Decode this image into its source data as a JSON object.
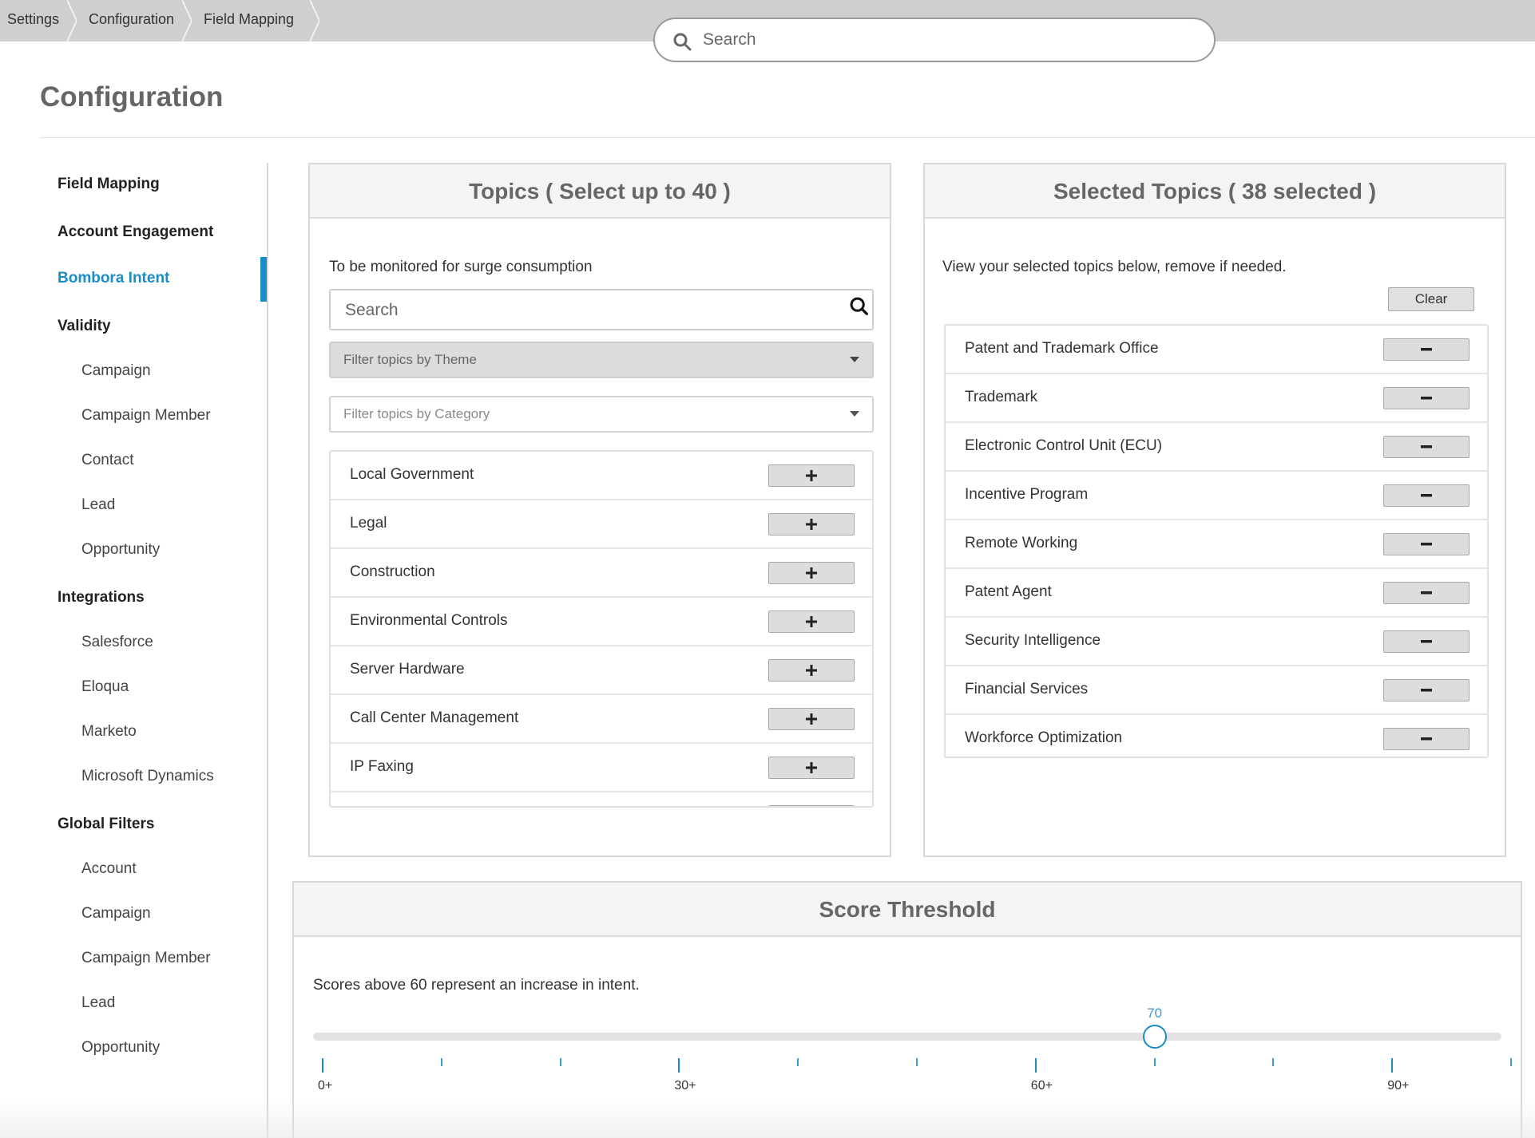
{
  "breadcrumb": [
    "Settings",
    "Configuration",
    "Field Mapping"
  ],
  "top_search": {
    "placeholder": "Search"
  },
  "page_title": "Configuration",
  "sidebar": {
    "items": [
      {
        "label": "Field Mapping",
        "kind": "head"
      },
      {
        "label": "Account Engagement",
        "kind": "head"
      },
      {
        "label": "Bombora Intent",
        "kind": "head",
        "active": true
      },
      {
        "label": "Validity",
        "kind": "head"
      },
      {
        "label": "Campaign",
        "kind": "sub"
      },
      {
        "label": "Campaign Member",
        "kind": "sub"
      },
      {
        "label": "Contact",
        "kind": "sub"
      },
      {
        "label": "Lead",
        "kind": "sub"
      },
      {
        "label": "Opportunity",
        "kind": "sub"
      },
      {
        "label": "Integrations",
        "kind": "head"
      },
      {
        "label": "Salesforce",
        "kind": "sub"
      },
      {
        "label": "Eloqua",
        "kind": "sub"
      },
      {
        "label": "Marketo",
        "kind": "sub"
      },
      {
        "label": "Microsoft Dynamics",
        "kind": "sub"
      },
      {
        "label": "Global Filters",
        "kind": "head"
      },
      {
        "label": "Account",
        "kind": "sub"
      },
      {
        "label": "Campaign",
        "kind": "sub"
      },
      {
        "label": "Campaign Member",
        "kind": "sub"
      },
      {
        "label": "Lead",
        "kind": "sub"
      },
      {
        "label": "Opportunity",
        "kind": "sub"
      }
    ]
  },
  "topics_panel": {
    "title": "Topics ( Select up to 40 )",
    "description": "To be monitored for surge consumption",
    "search_placeholder": "Search",
    "filter_theme": "Filter topics by Theme",
    "filter_category": "Filter topics by Category",
    "topics": [
      "Local Government",
      "Legal",
      "Construction",
      "Environmental Controls",
      "Server Hardware",
      "Call Center Management",
      "IP Faxing"
    ]
  },
  "selected_panel": {
    "title": "Selected Topics ( 38 selected )",
    "description": "View your selected topics below, remove if needed.",
    "clear_label": "Clear",
    "topics": [
      "Patent and Trademark Office",
      "Trademark",
      "Electronic Control Unit (ECU)",
      "Incentive Program",
      "Remote Working",
      "Patent Agent",
      "Security Intelligence",
      "Financial Services",
      "Workforce Optimization"
    ]
  },
  "score_panel": {
    "title": "Score Threshold",
    "description": "Scores above 60 represent an increase in intent.",
    "slider": {
      "min": 0,
      "max": 100,
      "value": 70,
      "value_label": "70",
      "tick_step": 10,
      "major_labels": [
        "0+",
        "30+",
        "60+",
        "90+"
      ]
    }
  },
  "colors": {
    "accent": "#1a8cc6",
    "topbar": "#cfcfcf"
  },
  "icons": {
    "search": "search-icon",
    "add": "plus-icon",
    "remove": "minus-icon",
    "dropdown": "caret-down-icon"
  }
}
